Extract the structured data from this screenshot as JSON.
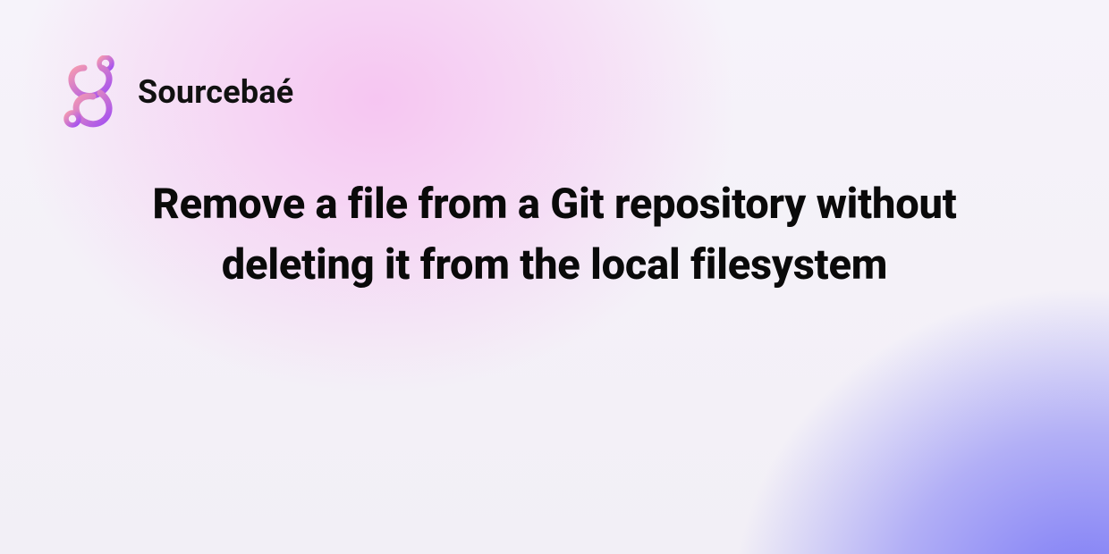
{
  "brand": {
    "name": "Sourcebaé",
    "logo_icon": "sourcebae-logo"
  },
  "headline": "Remove a file from a Git repository without deleting it from the local filesystem",
  "colors": {
    "logo_gradient_start": "#f59ab0",
    "logo_gradient_end": "#a24ff2",
    "bg_pink": "#f6bef0",
    "bg_purple": "#6e6cf5",
    "text": "#0a0a0a"
  }
}
